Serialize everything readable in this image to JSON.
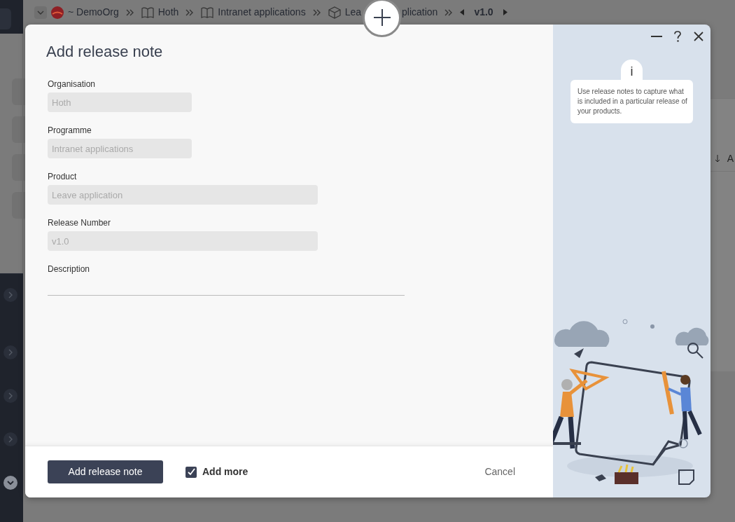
{
  "breadcrumb": {
    "items": [
      {
        "kind": "org",
        "label": "~ DemoOrg"
      },
      {
        "kind": "book",
        "label": "Hoth"
      },
      {
        "kind": "book",
        "label": "Intranet applications"
      },
      {
        "kind": "box",
        "label_start": "Lea",
        "label_end": "plication"
      }
    ],
    "version": "v1.0"
  },
  "background": {
    "column_header": "A"
  },
  "dialog": {
    "title": "Add release note",
    "fields": [
      {
        "kind": "short",
        "label": "Organisation",
        "value": "Hoth"
      },
      {
        "kind": "short",
        "label": "Programme",
        "value": "Intranet applications"
      },
      {
        "kind": "long",
        "label": "Product",
        "value": "Leave application"
      },
      {
        "kind": "long",
        "label": "Release Number",
        "value": "v1.0"
      },
      {
        "kind": "underline",
        "label": "Description"
      }
    ],
    "info_badge": "i",
    "info": "Use release notes to capture what is included in a particular release of your products.",
    "submit": "Add release note",
    "add_more": {
      "label": "Add more",
      "checked": true
    },
    "cancel": "Cancel"
  }
}
